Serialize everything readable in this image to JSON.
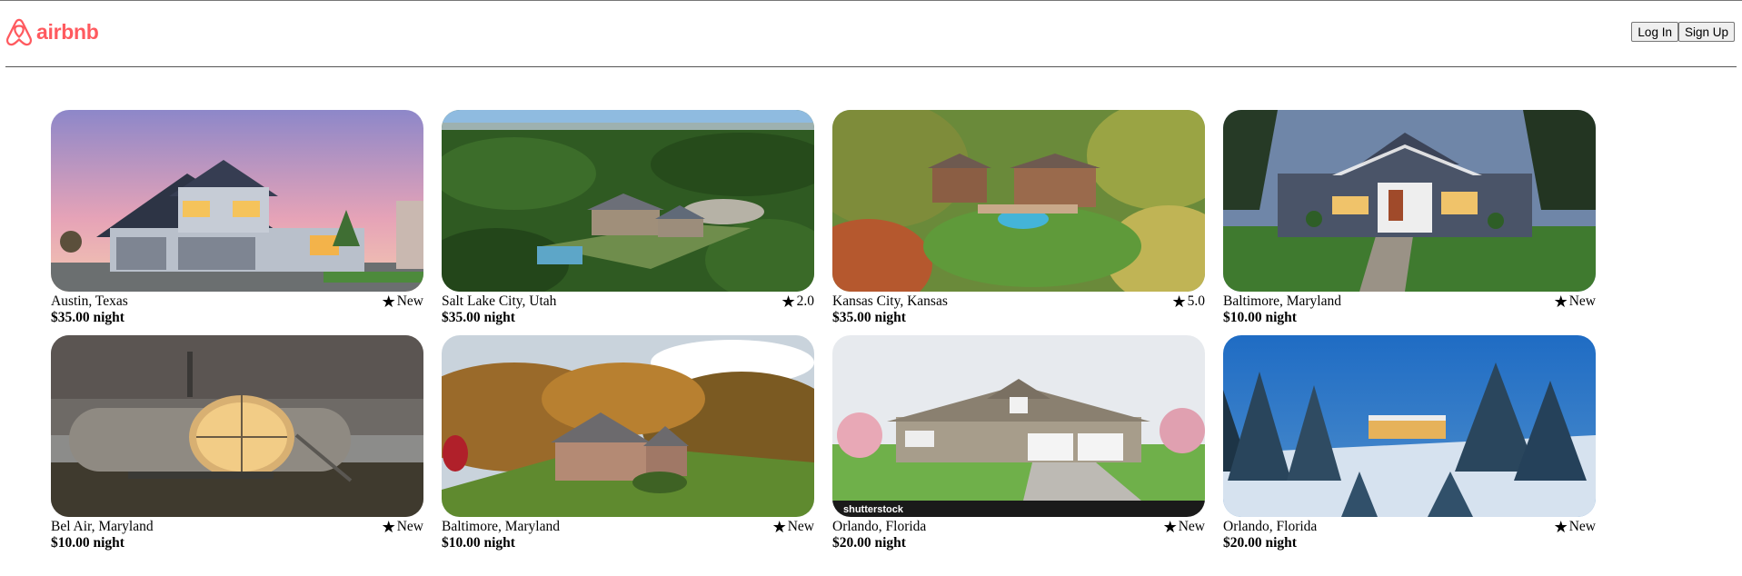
{
  "header": {
    "brand": "airbnb",
    "login_label": "Log In",
    "signup_label": "Sign Up"
  },
  "colors": {
    "brand": "#ff5a5f"
  },
  "listings": [
    {
      "location": "Austin, Texas",
      "rating": "New",
      "price": "$35.00 night",
      "image": "suburban-house-dusk"
    },
    {
      "location": "Salt Lake City, Utah",
      "rating": "2.0",
      "price": "$35.00 night",
      "image": "estate-aerial-forest"
    },
    {
      "location": "Kansas City, Kansas",
      "rating": "5.0",
      "price": "$35.00 night",
      "image": "mansion-pool-autumn"
    },
    {
      "location": "Baltimore, Maryland",
      "rating": "New",
      "price": "$10.00 night",
      "image": "craftsman-house-lawn"
    },
    {
      "location": "Bel Air, Maryland",
      "rating": "New",
      "price": "$10.00 night",
      "image": "futuro-pod-house"
    },
    {
      "location": "Baltimore, Maryland",
      "rating": "New",
      "price": "$10.00 night",
      "image": "country-house-fall"
    },
    {
      "location": "Orlando, Florida",
      "rating": "New",
      "price": "$20.00 night",
      "image": "suburban-house-driveway"
    },
    {
      "location": "Orlando, Florida",
      "rating": "New",
      "price": "$20.00 night",
      "image": "modern-house-snow"
    }
  ],
  "watermark": "shutterstock"
}
